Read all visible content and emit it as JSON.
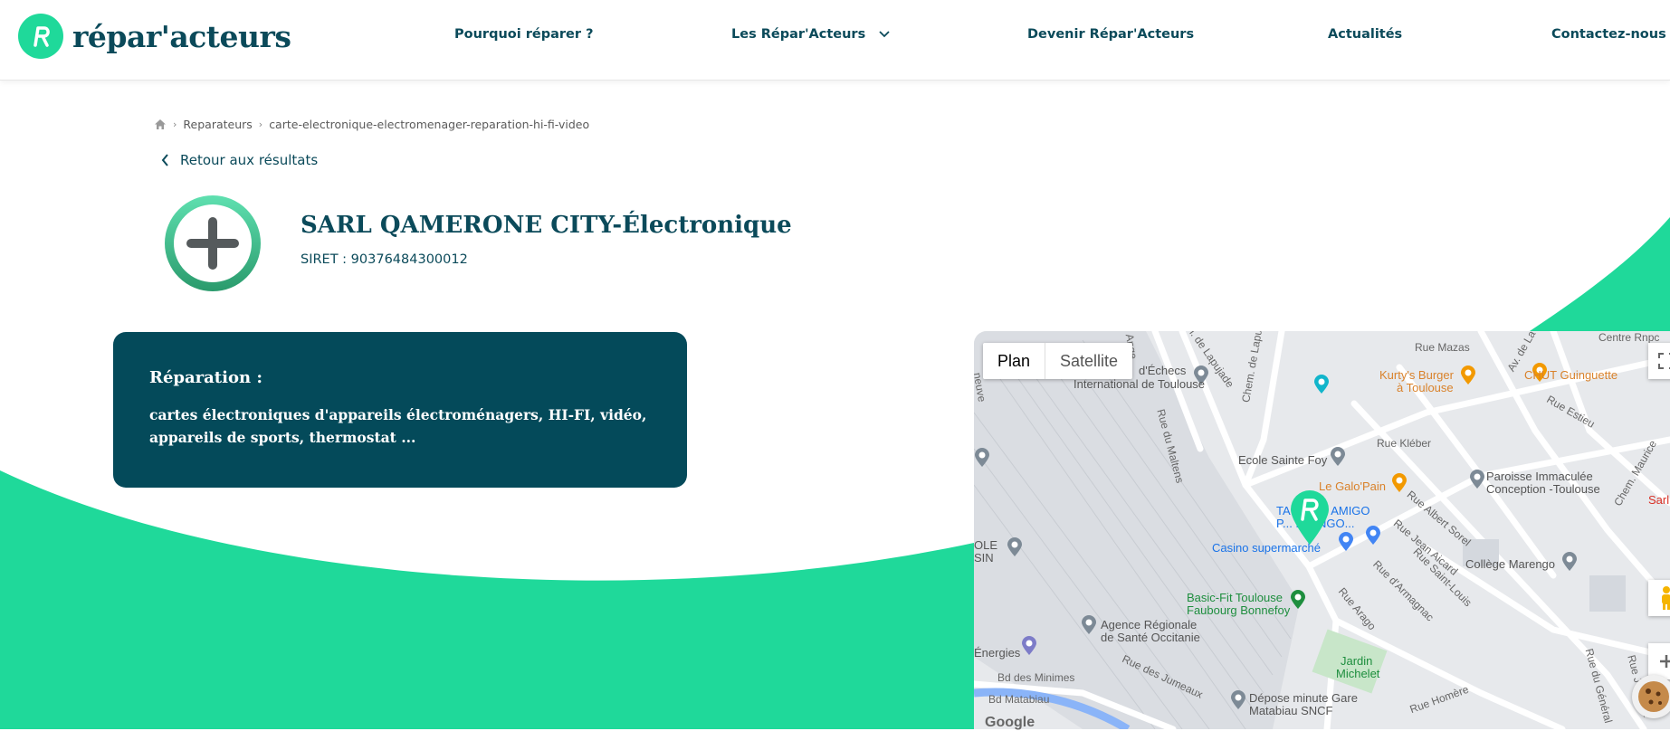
{
  "header": {
    "logo_text": "répar'acteurs",
    "nav": [
      {
        "label": "Pourquoi réparer ?"
      },
      {
        "label": "Les Répar'Acteurs"
      },
      {
        "label": "Devenir Répar'Acteurs"
      },
      {
        "label": "Actualités"
      },
      {
        "label": "Contactez-nous"
      }
    ]
  },
  "breadcrumb": {
    "items": [
      "Reparateurs",
      "carte-electronique-electromenager-reparation-hi-fi-video"
    ]
  },
  "back_label": "Retour aux résultats",
  "company": {
    "name": "SARL QAMERONE CITY-Électronique",
    "siret": "SIRET : 90376484300012"
  },
  "repair_card": {
    "title": "Réparation :",
    "text": "cartes électroniques d'appareils électroménagers, HI-FI, vidéo, appareils de sports, thermostat ..."
  },
  "map": {
    "toggle_plan": "Plan",
    "toggle_satellite": "Satellite",
    "labels": {
      "echecs": "d'Échecs",
      "international": "International de Toulouse",
      "lapujade": "Ch. de Lapujade",
      "chem_lapu": "Chem. de Lapuj",
      "mazas": "Rue Mazas",
      "kurtys": "Kurty's Burger",
      "a_toulouse": "à Toulouse",
      "chut": "CHUT Guinguette",
      "centre": "Centre Rnpc",
      "estieu": "Rue Estieu",
      "kleber": "Rue Kléber",
      "ecole": "Ecole Sainte Foy",
      "paroisse": "Paroisse Immaculée",
      "conception": "Conception -Toulouse",
      "galo": "Le Galo'Pain",
      "moto": "TA MOTO AMIGO",
      "django": "P... DJANGO...",
      "casino": "Casino supermarché",
      "albert_sorel": "Rue Albert Sorel",
      "jean_aicard": "Rue Jean Aicard",
      "marengo": "Collège Marengo",
      "saint_louis": "Rue Saint-Louis",
      "armagnac": "Rue d'Armagnac",
      "arago": "Rue Arago",
      "maltens": "Rue du Maltens",
      "ange": "Ange",
      "basic": "Basic-Fit Toulouse",
      "bonnefoy": "Faubourg Bonnefoy",
      "agence": "Agence Régionale",
      "sante": "de Santé Occitanie",
      "energies": "Énergies",
      "jumeaux": "Rue des Jumeaux",
      "minimes": "Bd des Minimes",
      "matabiau": "Bd Matabiau",
      "jardin": "Jardin",
      "michelet": "Michelet",
      "depose": "Dépose minute Gare",
      "matabiau_sncf": "Matabiau SNCF",
      "homere": "Rue Homère",
      "general": "Rue du Général",
      "jolimont": "Rue Jolimont",
      "maurice": "Chem. Maurice",
      "sarl": "Sarl",
      "ole": "OLE",
      "sin": "SIN",
      "av_de_la": "Av. de La",
      "neuve": "neuve",
      "google": "Google"
    }
  },
  "colors": {
    "brand_green": "#1fd99a",
    "brand_dark": "#0b4a5a",
    "card_bg": "#044a5a"
  }
}
